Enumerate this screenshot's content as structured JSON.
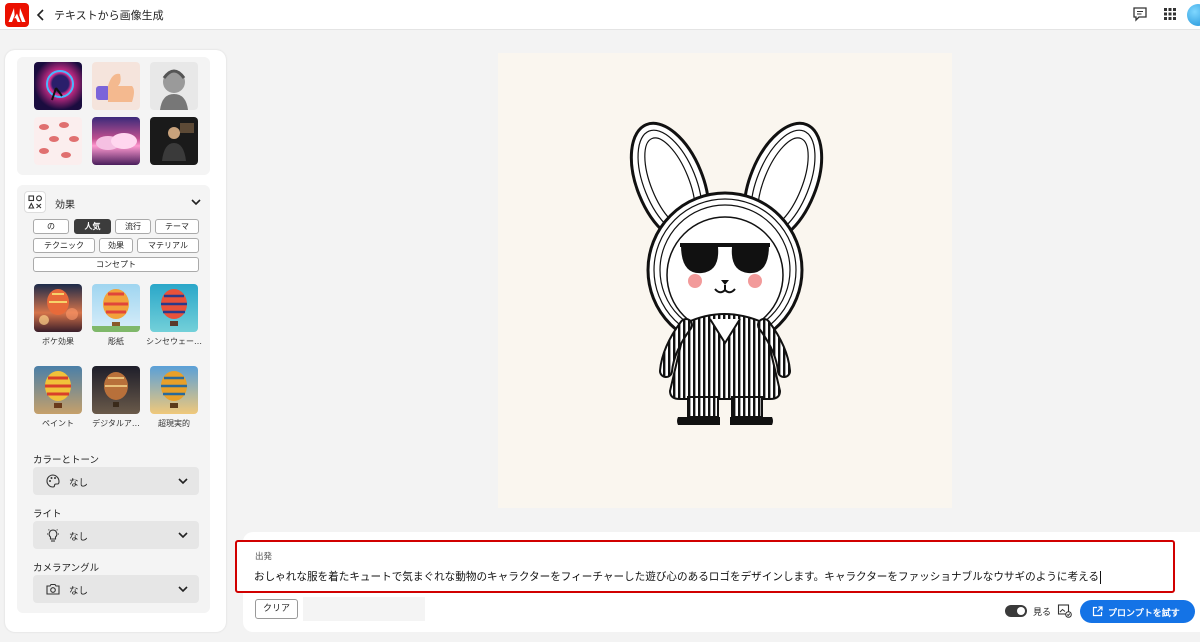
{
  "header": {
    "title": "テキストから画像生成"
  },
  "effects": {
    "title": "効果",
    "chips_row1": [
      "の",
      "人気",
      "流行",
      "テーマ"
    ],
    "chips_row2": [
      "テクニック",
      "効果",
      "マテリアル"
    ],
    "chips_row3": [
      "コンセプト"
    ],
    "active_chip": "人気",
    "styles_row1": [
      "ボケ効果",
      "彫紙",
      "シンセウェー…"
    ],
    "styles_row2": [
      "ペイント",
      "デジタルア…",
      "超現実的"
    ]
  },
  "color_tone": {
    "label": "カラーとトーン",
    "value": "なし"
  },
  "light": {
    "label": "ライト",
    "value": "なし"
  },
  "camera": {
    "label": "カメラアングル",
    "value": "なし"
  },
  "prompt": {
    "label": "出発",
    "text": "おしゃれな服を着たキュートで気まぐれな動物のキャラクターをフィーチャーした遊び心のあるロゴをデザインします。キャラクターをファッショナブルなウサギのように考える"
  },
  "actions": {
    "clear": "クリア",
    "view": "見る",
    "try_prompt": "プロンプトを試す"
  },
  "colors": {
    "accent": "#1473e6",
    "brand": "#eb1000",
    "highlight_border": "#d10000"
  }
}
